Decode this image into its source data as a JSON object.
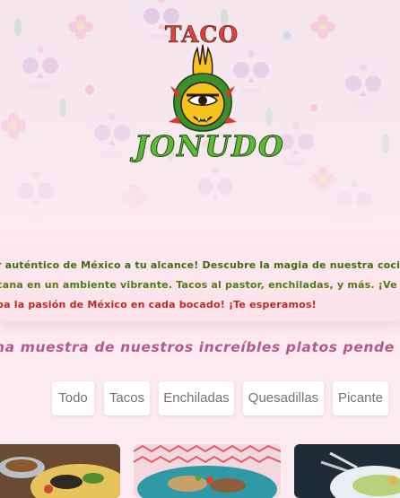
{
  "brand": {
    "name_top": "TACO",
    "name_bottom": "JONUDO"
  },
  "about": {
    "line1": "r auténtico de México a tu alcance! Descubre la magia de nuestra coci",
    "line2": "cana en un ambiente vibrante. Tacos al pastor, enchiladas, y más. ¡Ve",
    "line3": "pa la pasión de México en cada bocado! ¡Te esperamos!"
  },
  "menu": {
    "heading": "na muestra de nuestros increíbles platos pende",
    "filters": [
      {
        "label": "Todo"
      },
      {
        "label": "Tacos"
      },
      {
        "label": "Enchiladas"
      },
      {
        "label": "Quesadillas"
      },
      {
        "label": "Picante"
      }
    ]
  },
  "colors": {
    "background": "#fbeaf0",
    "about_green": "#3f6c12",
    "about_red": "#c4271f",
    "heading": "#b25a8a",
    "logo_red": "#e2413a",
    "logo_green": "#5cba37",
    "logo_yellow": "#f7c21b"
  },
  "icons": [
    "sugar-skull-icon",
    "sun-face-logo-icon",
    "eye-icon"
  ]
}
